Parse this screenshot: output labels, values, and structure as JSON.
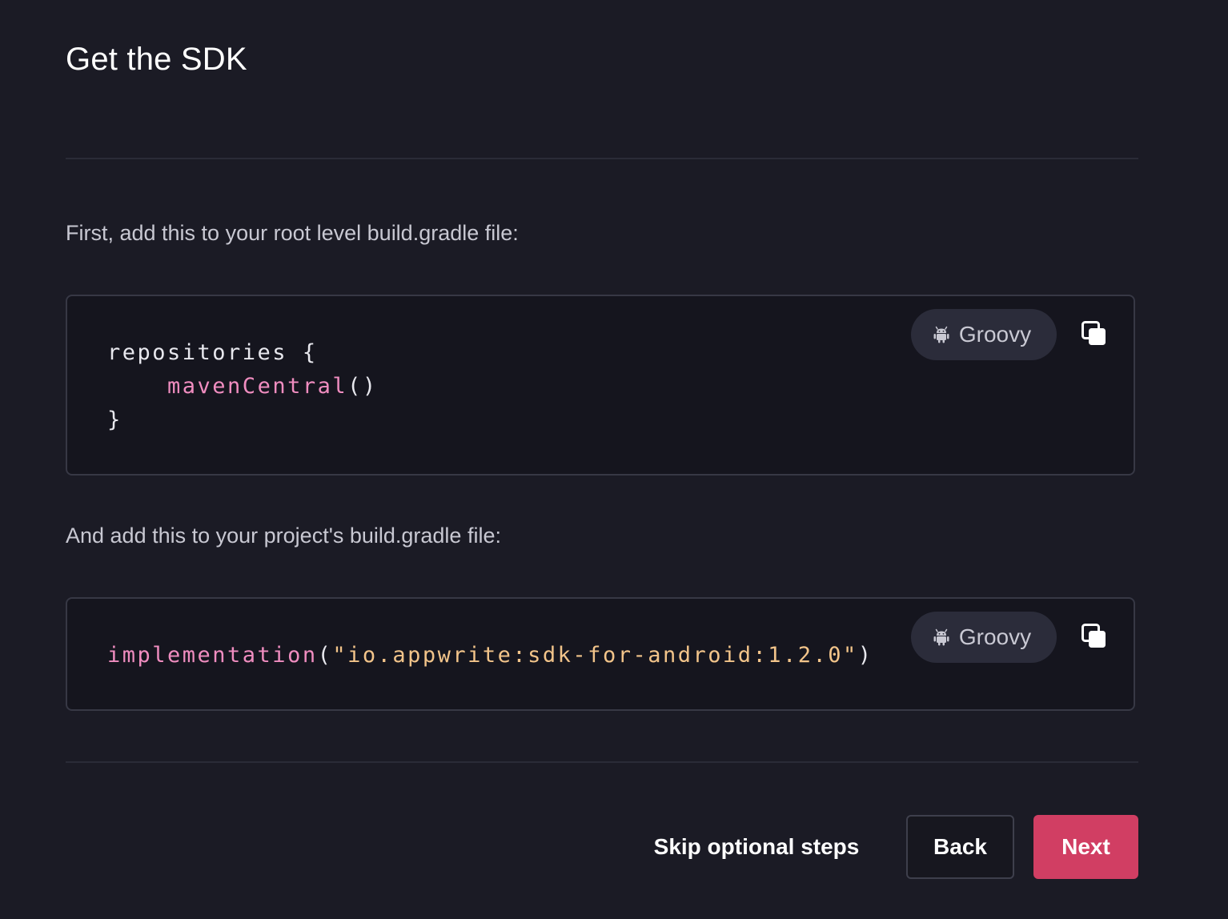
{
  "page": {
    "title": "Get the SDK"
  },
  "steps": {
    "root_instruction": "First, add this to your root level build.gradle file:",
    "project_instruction": "And add this to your project's build.gradle file:"
  },
  "code_blocks": [
    {
      "language": "Groovy",
      "language_icon": "android-icon",
      "copy_icon": "copy-icon",
      "lines": {
        "l1": "repositories {",
        "l2_indent": "    ",
        "l2_fn": "mavenCentral",
        "l2_rest": "()",
        "l3": "}"
      }
    },
    {
      "language": "Groovy",
      "language_icon": "android-icon",
      "copy_icon": "copy-icon",
      "lines": {
        "fn": "implementation",
        "open": "(",
        "str": "\"io.appwrite:sdk-for-android:1.2.0\"",
        "close": ")"
      }
    }
  ],
  "footer": {
    "skip_label": "Skip optional steps",
    "back_label": "Back",
    "next_label": "Next"
  },
  "colors": {
    "background": "#1b1b25",
    "accent": "#d13e63",
    "code_function": "#f08dc0",
    "code_string": "#f2c48a"
  }
}
